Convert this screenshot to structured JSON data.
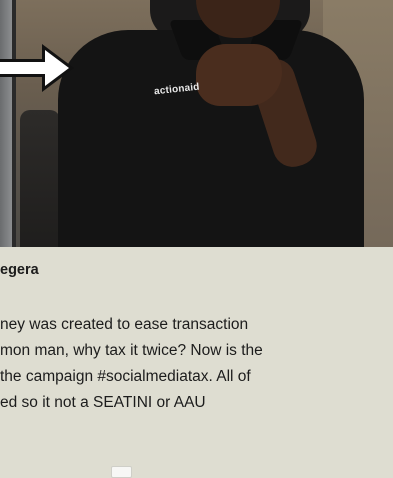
{
  "photo": {
    "alt": "man in black actionaid polo shirt seated in office chair",
    "shirt_logo": "actionaid"
  },
  "caption": {
    "name": "egera",
    "quote_lines": [
      "ney was created to ease transaction",
      "mon man, why tax it twice? Now is the",
      "the campaign #socialmediatax. All of",
      "ed so it not a SEATINI or AAU"
    ]
  },
  "colors": {
    "background": "#deddd1",
    "text": "#1c1c1c",
    "arrow_fill": "#ffffff",
    "arrow_stroke": "#111111"
  }
}
